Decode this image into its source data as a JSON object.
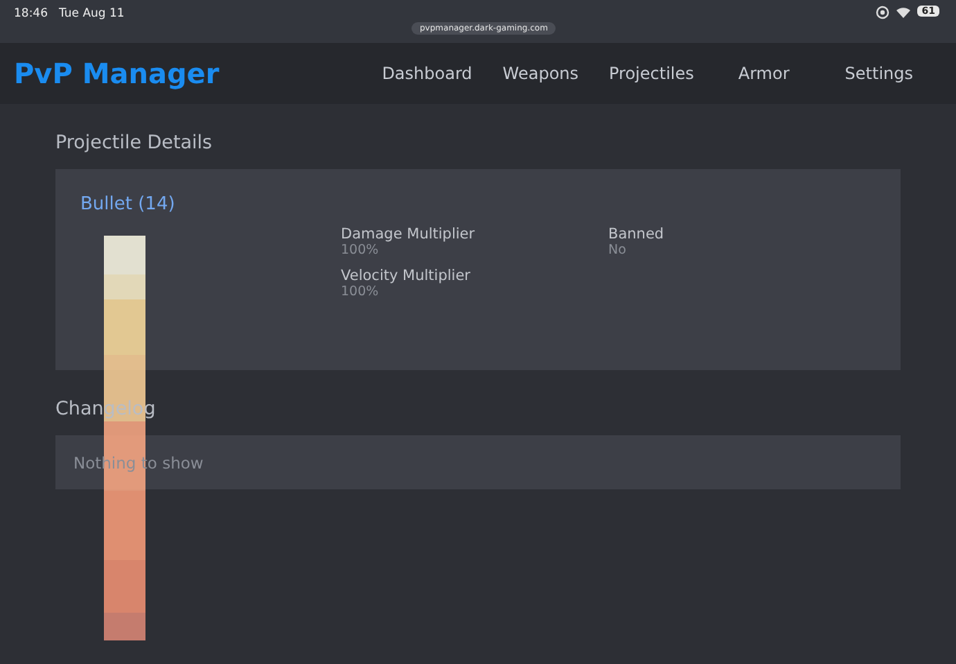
{
  "status_bar": {
    "time": "18:46",
    "date": "Tue Aug 11",
    "battery": "61",
    "url": "pvpmanager.dark-gaming.com"
  },
  "nav": {
    "logo": "PvP Manager",
    "items": [
      {
        "label": "Dashboard"
      },
      {
        "label": "Weapons"
      },
      {
        "label": "Projectiles"
      },
      {
        "label": "Armor"
      },
      {
        "label": "Settings"
      }
    ]
  },
  "page_title": "Projectile Details",
  "projectile": {
    "name": "Bullet (14)",
    "fields": [
      {
        "label": "Damage Multiplier",
        "value": "100%"
      },
      {
        "label": "Velocity Multiplier",
        "value": "100%"
      },
      {
        "label": "Banned",
        "value": "No"
      }
    ]
  },
  "changelog": {
    "title": "Changelog",
    "empty_text": "Nothing to show"
  }
}
